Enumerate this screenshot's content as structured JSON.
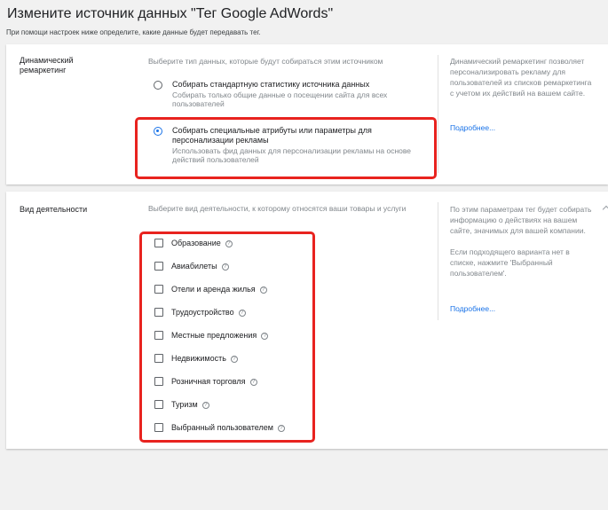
{
  "header": {
    "title": "Измените источник данных \"Тег Google AdWords\"",
    "subtitle": "При помощи настроек ниже определите, какие данные будет передавать тег."
  },
  "remarketing": {
    "label": "Динамический ремаркетинг",
    "description": "Выберите тип данных, которые будут собираться этим источником",
    "options": [
      {
        "title": "Собирать стандартную статистику источника данных",
        "subtitle": "Собирать только общие данные о посещении сайта для всех пользователей",
        "selected": false
      },
      {
        "title": "Собирать специальные атрибуты или параметры для персонализации рекламы",
        "subtitle": "Использовать фид данных для персонализации рекламы на основе действий пользователей",
        "selected": true
      }
    ],
    "help_text": "Динамический ремаркетинг позволяет персонализировать рекламу для пользователей из списков ремаркетинга с учетом их действий на вашем сайте.",
    "help_link": "Подробнее..."
  },
  "activity": {
    "label": "Вид деятельности",
    "description": "Выберите вид деятельности, к которому относятся ваши товары и услуги",
    "items": [
      {
        "label": "Образование",
        "checked": false
      },
      {
        "label": "Авиабилеты",
        "checked": false
      },
      {
        "label": "Отели и аренда жилья",
        "checked": false
      },
      {
        "label": "Трудоустройство",
        "checked": false
      },
      {
        "label": "Местные предложения",
        "checked": false
      },
      {
        "label": "Недвижимость",
        "checked": false
      },
      {
        "label": "Розничная торговля",
        "checked": false
      },
      {
        "label": "Туризм",
        "checked": false
      },
      {
        "label": "Выбранный пользователем",
        "checked": false
      }
    ],
    "help_text_1": "По этим параметрам тег будет собирать информацию о действиях на вашем сайте, значимых для вашей компании.",
    "help_text_2": "Если подходящего варианта нет в списке, нажмите 'Выбранный пользователем'.",
    "help_link": "Подробнее..."
  },
  "icons": {
    "help": "help-circle-icon",
    "radio": "radio-icon",
    "checkbox": "checkbox-icon"
  },
  "colors": {
    "accent": "#1a73e8",
    "highlight": "#e8231f",
    "background": "#f1f1f1"
  }
}
